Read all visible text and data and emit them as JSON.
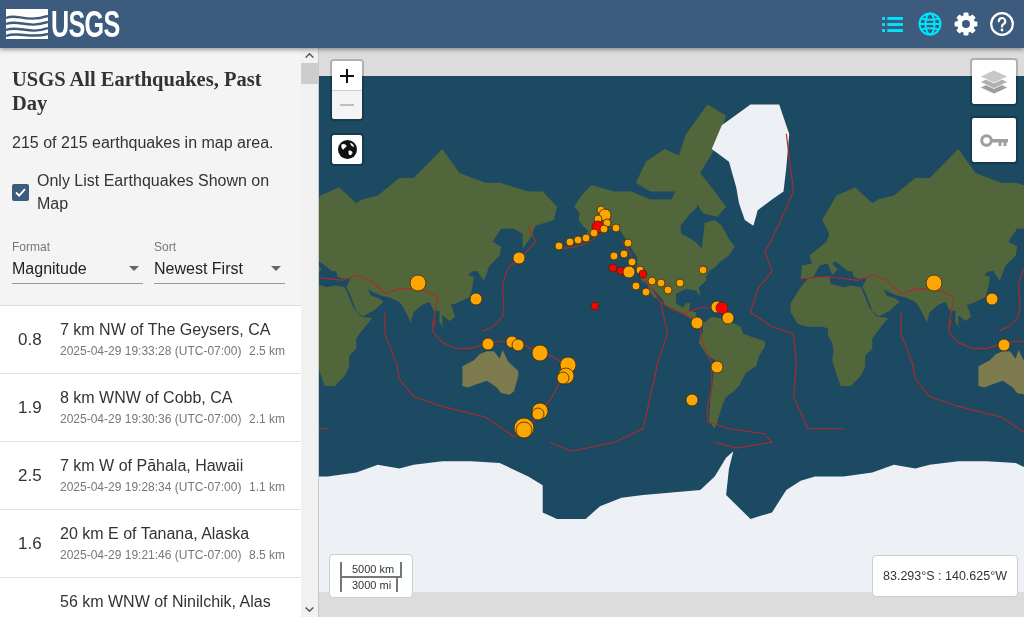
{
  "header": {
    "logo_text": "USGS",
    "nav_icons": [
      {
        "kind": "list",
        "selected": true
      },
      {
        "kind": "map",
        "selected": true
      },
      {
        "kind": "settings",
        "selected": false
      },
      {
        "kind": "help",
        "selected": false
      }
    ]
  },
  "sidebar": {
    "title": "USGS All Earthquakes, Past Day",
    "summary": "215 of 215 earthquakes in map area.",
    "filter_checkbox": {
      "label": "Only List Earthquakes Shown on Map",
      "checked": true
    },
    "selects": [
      {
        "label": "Format",
        "value": "Magnitude"
      },
      {
        "label": "Sort",
        "value": "Newest First"
      }
    ],
    "earthquakes": [
      {
        "magnitude": "0.8",
        "place": "7 km NW of The Geysers, CA",
        "time": "2025-04-29 19:33:28 (UTC-07:00)",
        "depth": "2.5 km"
      },
      {
        "magnitude": "1.9",
        "place": "8 km WNW of Cobb, CA",
        "time": "2025-04-29 19:30:36 (UTC-07:00)",
        "depth": "2.1 km"
      },
      {
        "magnitude": "2.5",
        "place": "7 km W of Pāhala, Hawaii",
        "time": "2025-04-29 19:28:34 (UTC-07:00)",
        "depth": "1.1 km"
      },
      {
        "magnitude": "1.6",
        "place": "20 km E of Tanana, Alaska",
        "time": "2025-04-29 19:21:46 (UTC-07:00)",
        "depth": "8.5 km"
      },
      {
        "place": "56 km WNW of Ninilchik, Alas"
      }
    ]
  },
  "map": {
    "zoom_buttons": [
      {
        "kind": "zoom-in",
        "disabled": false
      },
      {
        "kind": "zoom-out",
        "disabled": true
      }
    ],
    "markers": [
      {
        "kind": "small",
        "color": "#ffa500"
      },
      {
        "kind": "medium",
        "color": "#ffa500"
      },
      {
        "kind": "small",
        "color": "#ffa500"
      },
      {
        "kind": "small",
        "color": "#ffa500"
      },
      {
        "kind": "medium",
        "color": "#ff0000"
      },
      {
        "kind": "small",
        "color": "#ffa500"
      },
      {
        "kind": "small",
        "color": "#ffa500"
      },
      {
        "kind": "small",
        "color": "#ffa500"
      },
      {
        "kind": "small",
        "color": "#ffa500"
      },
      {
        "kind": "small",
        "color": "#ffa500"
      },
      {
        "kind": "small",
        "color": "#ffa500"
      },
      {
        "kind": "small",
        "color": "#ffa500"
      },
      {
        "kind": "small",
        "color": "#ffa500"
      },
      {
        "kind": "small",
        "color": "#ffa500"
      },
      {
        "kind": "small",
        "color": "#ffa500"
      },
      {
        "kind": "small",
        "color": "#ffa500"
      },
      {
        "kind": "small",
        "color": "#ff0000"
      },
      {
        "kind": "small",
        "color": "#ff0000"
      },
      {
        "kind": "medium",
        "color": "#ffa500"
      },
      {
        "kind": "small",
        "color": "#ffa500"
      },
      {
        "kind": "small",
        "color": "#ff0000"
      },
      {
        "kind": "small",
        "color": "#ffa500"
      },
      {
        "kind": "small",
        "color": "#ffa500"
      },
      {
        "kind": "small",
        "color": "#ffa500"
      },
      {
        "kind": "small",
        "color": "#ffa500"
      },
      {
        "kind": "small",
        "color": "#ffa500"
      },
      {
        "kind": "small",
        "color": "#ffa500"
      },
      {
        "kind": "small",
        "color": "#ffa500"
      },
      {
        "kind": "medium",
        "color": "#ffa500"
      },
      {
        "kind": "medium",
        "color": "#ffa500"
      },
      {
        "kind": "medium",
        "color": "#ff0000"
      },
      {
        "kind": "medium",
        "color": "#ffa500"
      },
      {
        "kind": "medium",
        "color": "#ffa500"
      },
      {
        "kind": "medium",
        "color": "#ffa500"
      },
      {
        "kind": "small",
        "color": "#ff0000"
      },
      {
        "kind": "medium",
        "color": "#ffa500"
      },
      {
        "kind": "large",
        "color": "#ffa500"
      },
      {
        "kind": "medium",
        "color": "#ffa500"
      },
      {
        "kind": "medium",
        "color": "#ffa500"
      },
      {
        "kind": "medium",
        "color": "#ffa500"
      },
      {
        "kind": "medium",
        "color": "#ffa500"
      },
      {
        "kind": "large",
        "color": "#ffa500"
      },
      {
        "kind": "large",
        "color": "#ffa500"
      },
      {
        "kind": "large",
        "color": "#ffa500"
      },
      {
        "kind": "medium",
        "color": "#ffa500"
      },
      {
        "kind": "large",
        "color": "#ffa500"
      },
      {
        "kind": "medium",
        "color": "#ffa500"
      },
      {
        "kind": "xlarge",
        "color": "#ffa500"
      },
      {
        "kind": "large",
        "color": "#ffa500"
      },
      {
        "kind": "large",
        "color": "#ffa500"
      },
      {
        "kind": "medium",
        "color": "#ffa500"
      },
      {
        "kind": "medium",
        "color": "#ffa500"
      }
    ],
    "scale": {
      "metric": "5000 km",
      "imperial": "3000 mi"
    },
    "cursor_position": "83.293°S : 140.625°W"
  }
}
